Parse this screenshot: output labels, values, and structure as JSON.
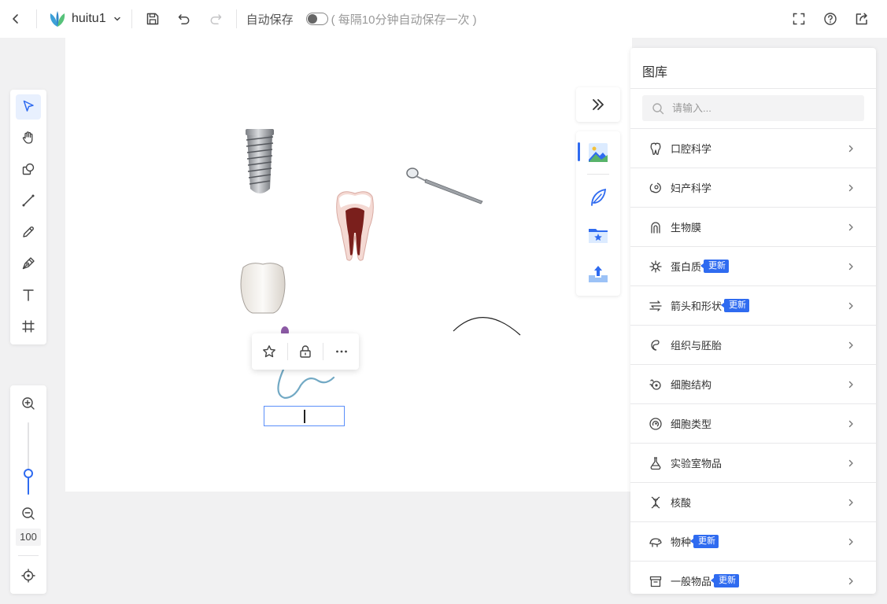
{
  "topbar": {
    "title": "huitu1",
    "autosave_label": "自动保存",
    "autosave_hint": "( 每隔10分钟自动保存一次 )"
  },
  "zoom": {
    "value": "100",
    "level_fraction": 0.29
  },
  "library": {
    "title": "图库",
    "search_placeholder": "请输入...",
    "badge_new": "更新",
    "categories": [
      {
        "label": "口腔科学",
        "icon": "tooth-icon",
        "badge": ""
      },
      {
        "label": "妇产科学",
        "icon": "fetus-icon",
        "badge": ""
      },
      {
        "label": "生物膜",
        "icon": "biofilm-icon",
        "badge": ""
      },
      {
        "label": "蛋白质",
        "icon": "protein-icon",
        "badge": "更新"
      },
      {
        "label": "箭头和形状",
        "icon": "arrows-icon",
        "badge": "更新"
      },
      {
        "label": "组织与胚胎",
        "icon": "embryo-icon",
        "badge": ""
      },
      {
        "label": "细胞结构",
        "icon": "cell-structure-icon",
        "badge": ""
      },
      {
        "label": "细胞类型",
        "icon": "cell-type-icon",
        "badge": ""
      },
      {
        "label": "实验室物品",
        "icon": "flask-icon",
        "badge": ""
      },
      {
        "label": "核酸",
        "icon": "dna-icon",
        "badge": ""
      },
      {
        "label": "物种",
        "icon": "species-icon",
        "badge": "更新"
      },
      {
        "label": "一般物品",
        "icon": "box-icon",
        "badge": "更新"
      }
    ]
  },
  "colors": {
    "accent": "#2f6bf0",
    "canvas": "#ffffff",
    "workspace": "#f1f1f2"
  }
}
